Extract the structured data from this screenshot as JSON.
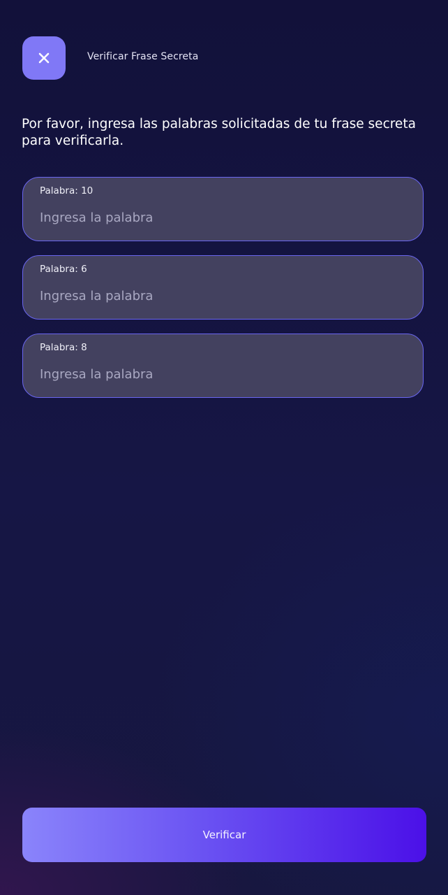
{
  "header": {
    "close_icon": "close-icon",
    "title": "Verificar Frase Secreta"
  },
  "instructions": "Por favor, ingresa las palabras solicitadas de tu frase secreta para verificarla.",
  "fields": [
    {
      "label": "Palabra: 10",
      "value": "",
      "placeholder": "Ingresa la palabra"
    },
    {
      "label": "Palabra: 6",
      "value": "",
      "placeholder": "Ingresa la palabra"
    },
    {
      "label": "Palabra: 8",
      "value": "",
      "placeholder": "Ingresa la palabra"
    }
  ],
  "verify_button": {
    "label": "Verificar"
  },
  "colors": {
    "accent": "#8078f6",
    "field_border": "#6a66f0",
    "field_background": "#43415f",
    "button_gradient_start": "#8a84fb",
    "button_gradient_end": "#4b10e8",
    "background": "#12113a"
  }
}
